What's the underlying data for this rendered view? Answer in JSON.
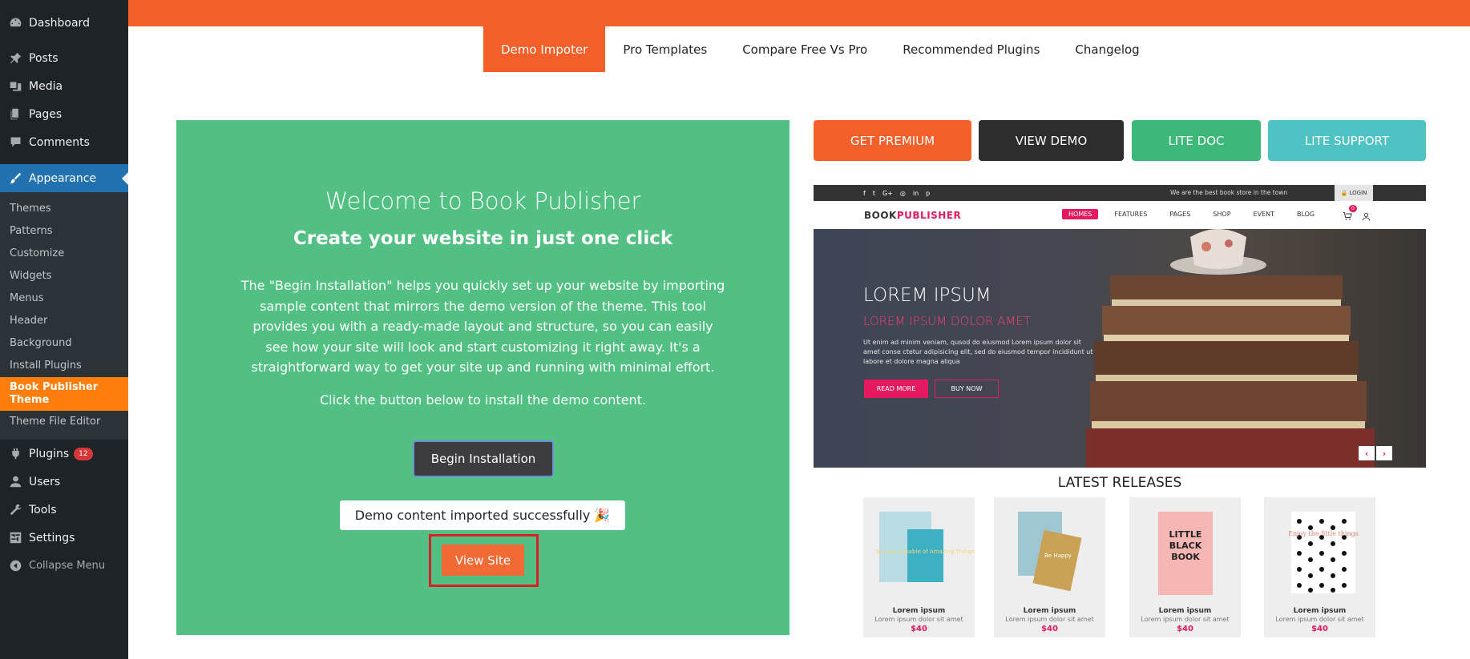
{
  "sidebar": {
    "top": [
      {
        "label": "Dashboard",
        "icon": "dashboard-icon"
      },
      {
        "label": "Posts",
        "icon": "pin-icon"
      },
      {
        "label": "Media",
        "icon": "media-icon"
      },
      {
        "label": "Pages",
        "icon": "pages-icon"
      },
      {
        "label": "Comments",
        "icon": "comment-icon"
      },
      {
        "label": "Appearance",
        "icon": "paintbrush-icon"
      }
    ],
    "appearance_sub": [
      "Themes",
      "Patterns",
      "Customize",
      "Widgets",
      "Menus",
      "Header",
      "Background",
      "Install Plugins",
      "Book Publisher Theme",
      "Theme File Editor"
    ],
    "bottom": [
      {
        "label": "Plugins",
        "icon": "plugins-icon",
        "badge": "12"
      },
      {
        "label": "Users",
        "icon": "users-icon"
      },
      {
        "label": "Tools",
        "icon": "wrench-icon"
      },
      {
        "label": "Settings",
        "icon": "settings-icon"
      },
      {
        "label": "Collapse Menu",
        "icon": "collapse-icon"
      }
    ]
  },
  "tabs": [
    "Demo Impoter",
    "Pro Templates",
    "Compare Free Vs Pro",
    "Recommended Plugins",
    "Changelog"
  ],
  "welcome": {
    "title": "Welcome to Book Publisher",
    "subtitle": "Create your website in just one click",
    "description": "The \"Begin Installation\" helps you quickly set up your website by importing sample content that mirrors the demo version of the theme. This tool provides you with a ready-made layout and structure, so you can easily see how your site will look and start customizing it right away. It's a straightforward way to get your site up and running with minimal effort.",
    "click_text": "Click the button below to install the demo content.",
    "begin_button": "Begin Installation",
    "success_message": "Demo content imported successfully 🎉",
    "view_site_button": "View Site"
  },
  "actions": [
    {
      "label": "GET PREMIUM",
      "color": "#f55f2a"
    },
    {
      "label": "VIEW DEMO",
      "color": "#2d2d2d"
    },
    {
      "label": "LITE DOC",
      "color": "#3db87a"
    },
    {
      "label": "LITE SUPPORT",
      "color": "#4fc3c3"
    }
  ],
  "preview": {
    "social": [
      "f",
      "t",
      "G+",
      "◎",
      "in",
      "p"
    ],
    "tagline": "We are the best book store in the town",
    "login": "🔒 LOGIN",
    "logo_a": "BOOK",
    "logo_b": "PUBLISHER",
    "menu": [
      "HOMES",
      "FEATURES",
      "PAGES",
      "SHOP",
      "EVENT",
      "BLOG"
    ],
    "cart_count": "0",
    "hero_title": "LOREM IPSUM",
    "hero_subtitle": "LOREM IPSUM DOLOR AMET",
    "hero_text": "Ut enim ad minim veniam, qusod do eiusmod  Lorem ipsum dolor sit amet conse ctetur adipisicing elit, sed do eiusmod tempor incididunt ut labore et dolore magna aliqua",
    "read_more": "READ MORE",
    "buy_now": "BUY NOW",
    "latest_releases": "LATEST RELEASES",
    "books": [
      {
        "name": "Lorem ipsum",
        "desc": "Lorem ipsum dolor sit amet",
        "price": "$40",
        "cover_text": "You are Capable of Amazing Things"
      },
      {
        "name": "Lorem ipsum",
        "desc": "Lorem ipsum dolor sit amet",
        "price": "$40",
        "cover_text": "Be Happy"
      },
      {
        "name": "Lorem ipsum",
        "desc": "Lorem ipsum dolor sit amet",
        "price": "$40",
        "cover_text": "LITTLE BLACK BOOK"
      },
      {
        "name": "Lorem ipsum",
        "desc": "Lorem ipsum dolor sit amet",
        "price": "$40",
        "cover_text": "Enjoy the little things"
      }
    ]
  },
  "colors": {
    "accent": "#f55f2a",
    "sidebar_bg": "#1d2327",
    "wp_blue": "#2271b1",
    "welcome_bg": "#51c082",
    "active_submenu": "#ff7d0a"
  }
}
